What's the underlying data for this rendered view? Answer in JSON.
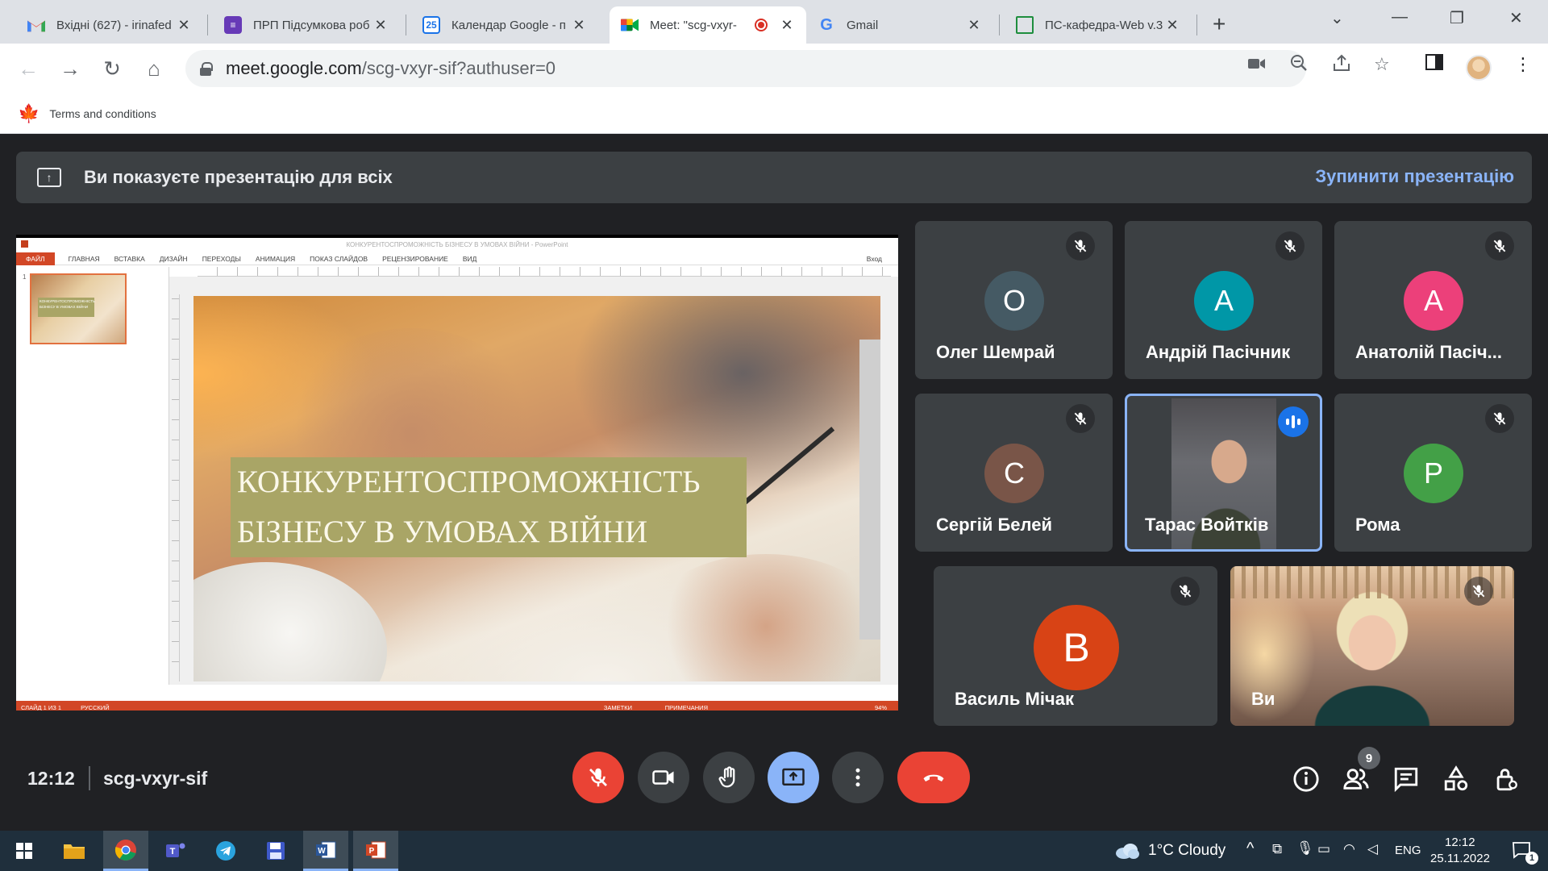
{
  "browser": {
    "tabs": [
      {
        "title": "Вхідні (627) - irinafed",
        "favicon": "gmail-icon",
        "color": "#ea4335"
      },
      {
        "title": "ПРП Підсумкова роб",
        "favicon": "forms-icon",
        "color": "#673ab7"
      },
      {
        "title": "Календар Google - п",
        "favicon": "calendar-icon",
        "color": "#1a73e8",
        "favtext": "25"
      },
      {
        "title": "Meet: \"scg-vxyr-",
        "favicon": "meet-icon",
        "color": "#00832d"
      },
      {
        "title": "Gmail",
        "favicon": "google-icon",
        "color": "#4285f4",
        "favtext": "G"
      },
      {
        "title": "ПС-кафедра-Web v.3",
        "favicon": "sites-icon",
        "color": "#1e8e3e"
      }
    ],
    "url_host": "meet.google.com",
    "url_path": "/scg-vxyr-sif?authuser=0",
    "bookmark": "Terms and conditions"
  },
  "meet": {
    "banner_text": "Ви показуєте презентацію для всіх",
    "stop_label": "Зупинити презентацію",
    "time": "12:12",
    "code": "scg-vxyr-sif",
    "participant_count": "9",
    "participants": [
      {
        "name": "Олег Шемрай",
        "initial": "О",
        "color": "#455a64"
      },
      {
        "name": "Андрій Пасічник",
        "initial": "А",
        "color": "#0097a7"
      },
      {
        "name": "Анатолій Пасіч...",
        "initial": "А",
        "color": "#ec407a"
      },
      {
        "name": "Сергій Белей",
        "initial": "С",
        "color": "#795548"
      },
      {
        "name": "Тарас Войтків",
        "initial": "",
        "color": "#3c4043"
      },
      {
        "name": "Рома",
        "initial": "Р",
        "color": "#43a047"
      },
      {
        "name": "Василь Мічак",
        "initial": "В",
        "color": "#d84315"
      },
      {
        "name": "Ви",
        "initial": "",
        "color": "#3c4043"
      }
    ]
  },
  "ppt": {
    "window_title": "КОНКУРЕНТОСПРОМОЖНІСТЬ БІЗНЕСУ В УМОВАХ ВІЙНИ - PowerPoint",
    "file_tab": "ФАЙЛ",
    "ribbon_tabs": [
      "ГЛАВНАЯ",
      "ВСТАВКА",
      "ДИЗАЙН",
      "ПЕРЕХОДЫ",
      "АНИМАЦИЯ",
      "ПОКАЗ СЛАЙДОВ",
      "РЕЦЕНЗИРОВАНИЕ",
      "ВИД"
    ],
    "login": "Вход",
    "thumb_num": "1",
    "thumb_text": "КОНКУРЕНТОСПРОМОЖНІСТЬ БІЗНЕСУ В УМОВАХ ВІЙНИ",
    "slide_line1": "КОНКУРЕНТОСПРОМОЖНІСТЬ",
    "slide_line2": "БІЗНЕСУ В УМОВАХ ВІЙНИ",
    "status_left": "СЛАЙД 1 ИЗ 1",
    "status_lang": "РУССКИЙ",
    "status_notes": "ЗАМЕТКИ",
    "status_comments": "ПРИМЕЧАНИЯ",
    "zoom": "94%"
  },
  "taskbar": {
    "weather": "1°C  Cloudy",
    "lang": "ENG",
    "time": "12:12",
    "date": "25.11.2022",
    "notif_count": "1"
  }
}
